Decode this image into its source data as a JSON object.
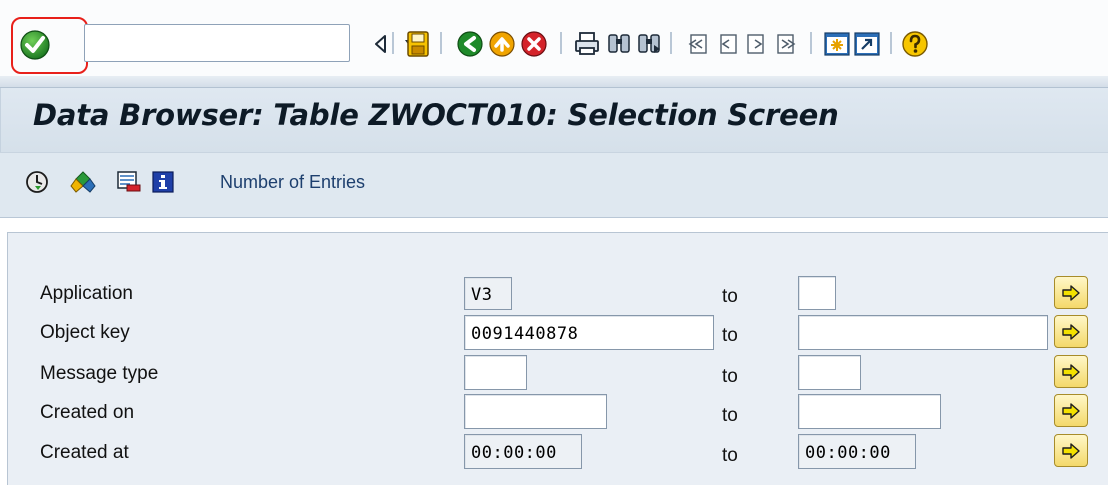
{
  "system_toolbar": {
    "command_field": {
      "value": "",
      "placeholder": ""
    },
    "icons": {
      "enter": "enter-checkmark-icon",
      "back_small": "triangle-left-icon",
      "save": "save-icon",
      "back": "back-icon",
      "exit": "exit-icon",
      "cancel": "cancel-icon",
      "print": "print-icon",
      "find": "find-icon",
      "find_next": "find-next-icon",
      "first_page": "first-page-icon",
      "prev_page": "previous-page-icon",
      "next_page": "next-page-icon",
      "last_page": "last-page-icon",
      "new_session": "new-session-icon",
      "shortcut": "shortcut-icon",
      "help": "help-icon"
    }
  },
  "title": "Data Browser: Table ZWOCT010: Selection Screen",
  "app_toolbar": {
    "icons": [
      "execute-icon",
      "selection-options-icon",
      "delete-selection-icon",
      "information-icon"
    ],
    "number_of_entries": "Number of Entries"
  },
  "selection": {
    "to_label": "to",
    "rows": [
      {
        "label": "Application",
        "low": "V3",
        "high": ""
      },
      {
        "label": "Object key",
        "low": "0091440878",
        "high": ""
      },
      {
        "label": "Message type",
        "low": "",
        "high": ""
      },
      {
        "label": "Created on",
        "low": "",
        "high": ""
      },
      {
        "label": "Created at",
        "low": "00:00:00",
        "high": "00:00:00"
      }
    ]
  },
  "colors": {
    "highlight": "#e8201a",
    "title_background": "#d5e0ea",
    "selection_background": "#eaeff5",
    "multiple_selection_button": "#f4d96a"
  }
}
